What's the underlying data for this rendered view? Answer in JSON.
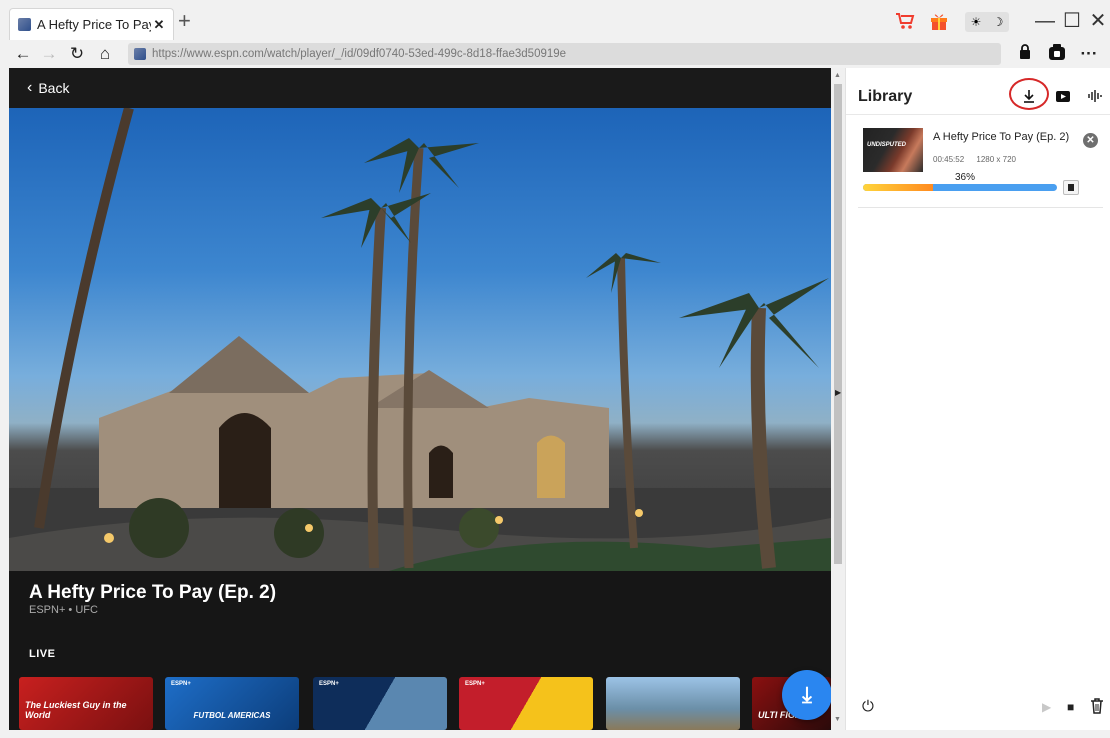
{
  "browser": {
    "tab_title": "A Hefty Price To Pay (",
    "tab_close": "✕",
    "new_tab": "+",
    "url": "https://www.espn.com/watch/player/_/id/09df0740-53ed-499c-8d18-ffae3d50919e",
    "theme_sun": "☀",
    "theme_moon": "☽",
    "minimize": "—",
    "maximize": "☐",
    "close": "✕",
    "more": "···"
  },
  "player": {
    "back_label": "Back",
    "show_title": "A Hefty Price To Pay (Ep. 2)",
    "show_subtitle": "ESPN+ • UFC",
    "live_label": "LIVE",
    "thumbnails": [
      {
        "tag": "",
        "text": "The Luckiest Guy in the World"
      },
      {
        "tag": "ESPN+",
        "text": "FUTBOL AMERICAS"
      },
      {
        "tag": "ESPN+",
        "text": ""
      },
      {
        "tag": "ESPN+",
        "text": ""
      },
      {
        "tag": "",
        "text": ""
      },
      {
        "tag": "",
        "text": "ULTI FIGHT"
      }
    ]
  },
  "library": {
    "title": "Library",
    "items": [
      {
        "name": "A Hefty Price To Pay (Ep. 2)",
        "duration": "00:45:52",
        "resolution": "1280 x 720",
        "progress_label": "36%",
        "progress": 0.36,
        "thumb_text": "UNDISPUTED"
      }
    ]
  },
  "colors": {
    "accent": "#2a86f0",
    "highlight": "#d62828",
    "progress_start": "#ffd43b",
    "progress_end": "#ff8a1f",
    "progress_track": "#4a9ff0"
  }
}
